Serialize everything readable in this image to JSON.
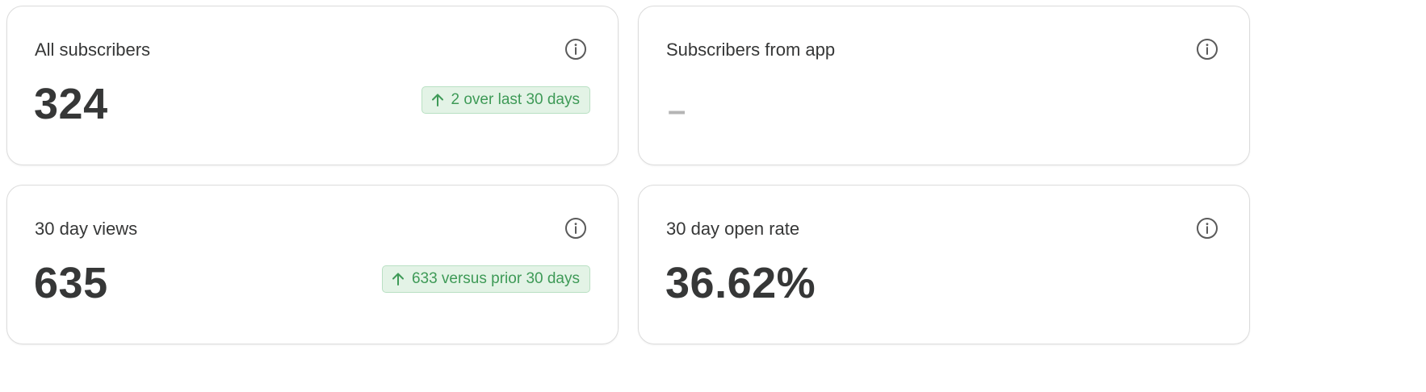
{
  "cards": [
    {
      "title": "All subscribers",
      "value": "324",
      "trend": {
        "direction": "up",
        "text": "2 over last 30 days"
      }
    },
    {
      "title": "Subscribers from app",
      "value": "–",
      "trend": null
    },
    {
      "title": "30 day views",
      "value": "635",
      "trend": {
        "direction": "up",
        "text": "633 versus prior 30 days"
      }
    },
    {
      "title": "30 day open rate",
      "value": "36.62%",
      "trend": null
    }
  ],
  "colors": {
    "text": "#363737",
    "muted": "#b5b5b5",
    "positive_text": "#3e9a57",
    "positive_bg": "#e3f3e6",
    "positive_border": "#b9e0c3",
    "card_border": "#dcdcdc"
  },
  "icons": {
    "info": "info-icon",
    "trend_up": "arrow-up-icon"
  }
}
